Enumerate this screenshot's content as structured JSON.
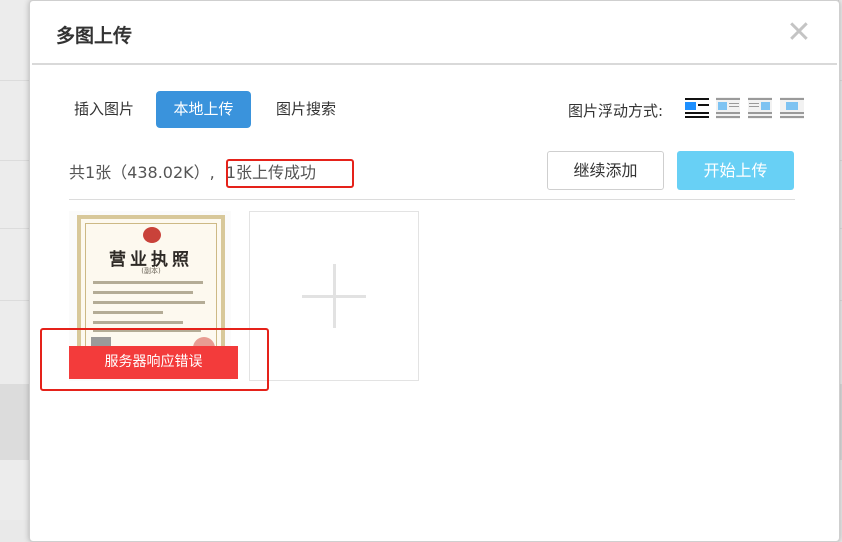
{
  "dialog": {
    "title": "多图上传",
    "close_glyph": "✕"
  },
  "tabs": [
    {
      "label": "插入图片",
      "active": false
    },
    {
      "label": "本地上传",
      "active": true
    },
    {
      "label": "图片搜索",
      "active": false
    }
  ],
  "float_options": {
    "label": "图片浮动方式:",
    "icons": [
      "float-none-icon",
      "float-left-icon",
      "float-right-icon",
      "float-center-icon"
    ]
  },
  "upload": {
    "summary_count": "共1张（438.02K）,",
    "summary_status": "1张上传成功",
    "continue_label": "继续添加",
    "start_label": "开始上传"
  },
  "files": [
    {
      "thumbnail_title": "营业执照",
      "thumbnail_subtitle": "(副本)",
      "error_text": "服务器响应错误"
    }
  ],
  "colors": {
    "accent": "#3a93dc",
    "start_button": "#68d0f5",
    "error": "#f33b3b",
    "annotation": "#e5221a"
  }
}
